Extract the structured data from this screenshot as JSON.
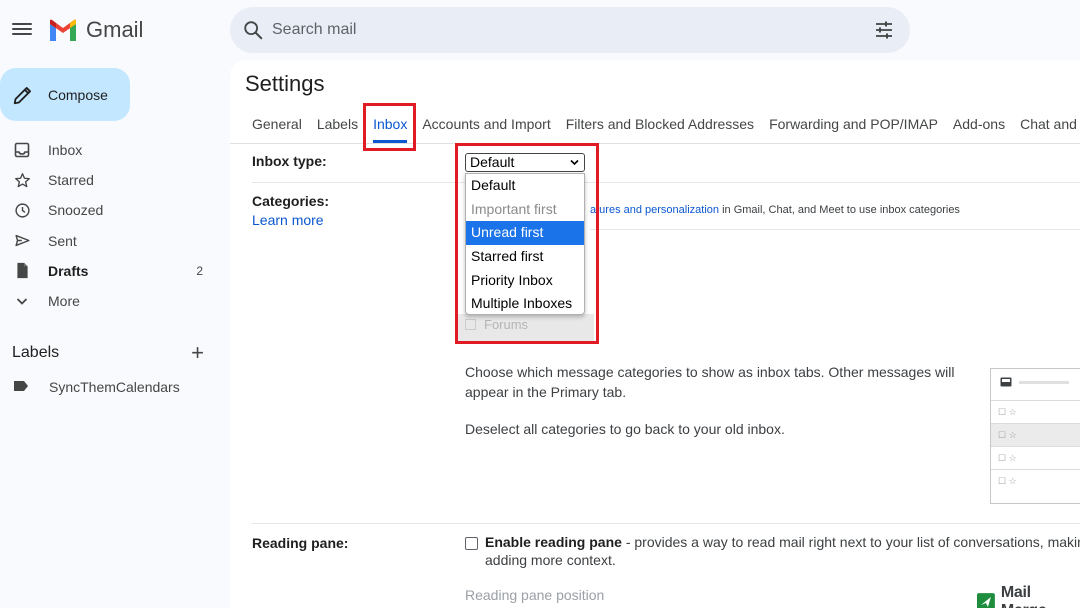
{
  "app": {
    "name": "Gmail"
  },
  "search": {
    "placeholder": "Search mail"
  },
  "compose": {
    "label": "Compose"
  },
  "nav": [
    {
      "label": "Inbox",
      "icon": "inbox-icon"
    },
    {
      "label": "Starred",
      "icon": "star-icon"
    },
    {
      "label": "Snoozed",
      "icon": "clock-icon"
    },
    {
      "label": "Sent",
      "icon": "send-icon"
    },
    {
      "label": "Drafts",
      "icon": "draft-icon",
      "count": "2",
      "bold": true
    },
    {
      "label": "More",
      "icon": "chevron-down-icon"
    }
  ],
  "labels": {
    "title": "Labels",
    "items": [
      {
        "label": "SyncThemCalendars",
        "icon": "label-icon"
      }
    ]
  },
  "settings": {
    "title": "Settings",
    "tabs": [
      "General",
      "Labels",
      "Inbox",
      "Accounts and Import",
      "Filters and Blocked Addresses",
      "Forwarding and POP/IMAP",
      "Add-ons",
      "Chat and Meet"
    ],
    "active_tab": "Inbox"
  },
  "inbox_type": {
    "label": "Inbox type:",
    "selected": "Default",
    "options": [
      "Default",
      "Important first",
      "Unread first",
      "Starred first",
      "Priority Inbox",
      "Multiple Inboxes"
    ],
    "highlighted": "Unread first",
    "disabled": "Important first"
  },
  "categories": {
    "label": "Categories:",
    "learn_more": "Learn more",
    "notice_link": "atures and personalization",
    "notice_rest": " in Gmail, Chat, and Meet to use inbox categories",
    "hidden_option": "Forums",
    "description_1": "Choose which message categories to show as inbox tabs. Other messages will appear in the Primary tab.",
    "description_2": "Deselect all categories to go back to your old inbox."
  },
  "reading_pane": {
    "label": "Reading pane:",
    "checkbox_label": "Enable reading pane",
    "description": " - provides a way to read mail right next to your list of conversations, making m",
    "description_2": "adding more context.",
    "position_label": "Reading pane position",
    "enabled": false
  },
  "watermark": {
    "label": "Mail Merge"
  },
  "colors": {
    "accent": "#0b57d0",
    "compose_bg": "#c2e7ff",
    "highlight": "#e01b24",
    "selected_option": "#1a73e8"
  }
}
